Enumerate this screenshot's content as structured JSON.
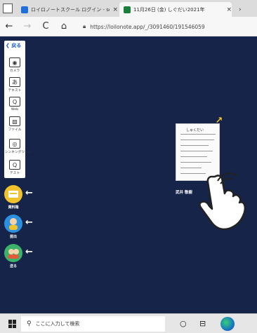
{
  "browser": {
    "tabs": [
      {
        "title": "ロイロノートスクール ログイン - search",
        "close": "×"
      },
      {
        "title": "11月26日 (金) しぐだい2021年",
        "close": "×"
      }
    ],
    "more_tabs": "›",
    "nav": {
      "back": "←",
      "forward": "→",
      "reload": "C",
      "home": "⌂"
    },
    "address": "https://loilonote.app/_/3091460/191546059"
  },
  "toolbar": {
    "back_label": "戻る",
    "tools": [
      {
        "label": "カメラ",
        "glyph": "◉"
      },
      {
        "label": "テキスト",
        "glyph": "あ"
      },
      {
        "label": "Web",
        "glyph": "Q"
      },
      {
        "label": "ファイル",
        "glyph": "▨"
      },
      {
        "label": "シンキングツール",
        "glyph": "◎"
      },
      {
        "label": "テスト",
        "glyph": "Q"
      }
    ]
  },
  "side_buttons": [
    {
      "label": "資料箱",
      "arrow": "←",
      "color": "#f0c22b"
    },
    {
      "label": "提出",
      "arrow": "←",
      "color": "#2c8fe0"
    },
    {
      "label": "送る",
      "arrow": "←",
      "color": "#3bb36a"
    }
  ],
  "card": {
    "title": "しゅくだい",
    "name": "武井 敬樹",
    "expand_arrow": "→"
  },
  "taskbar": {
    "search_placeholder": "ここに入力して検索",
    "search_icon": "search-icon",
    "task_view_icon": "task-view-icon",
    "widgets_icon": "widgets-icon"
  }
}
